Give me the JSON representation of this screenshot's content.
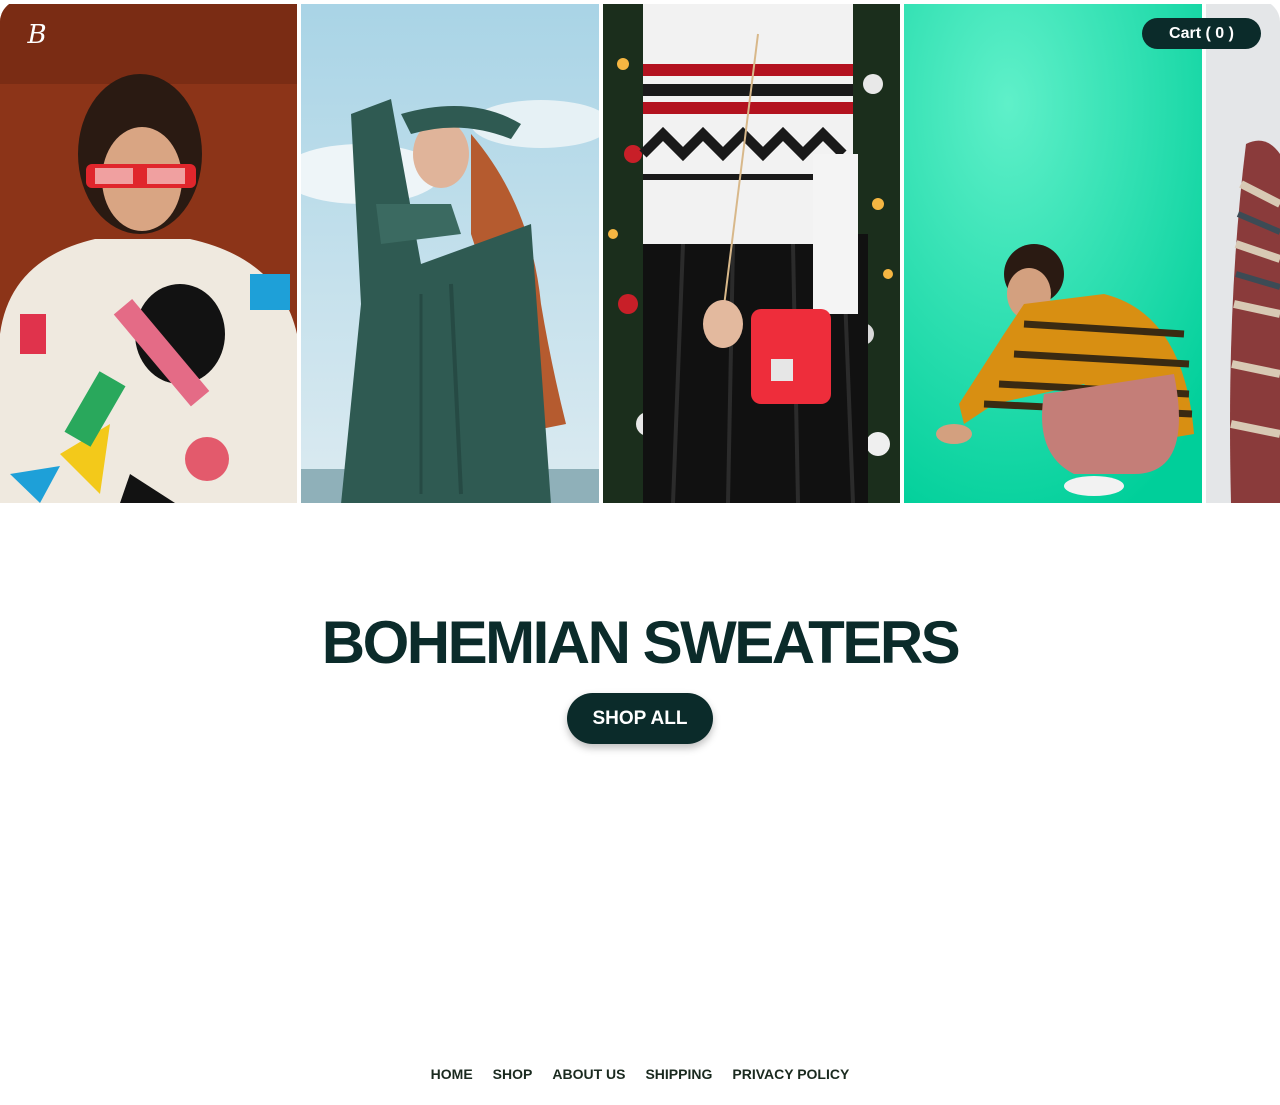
{
  "brand": {
    "logo_letter": "B"
  },
  "header": {
    "cart_label": "Cart ( 0 )"
  },
  "gallery": {
    "photos": [
      {
        "alt": "woman in colorful abstract knit sweater"
      },
      {
        "alt": "woman in green cable knit sweater"
      },
      {
        "alt": "woman in red and white fair isle sweater"
      },
      {
        "alt": "man in striped sweater on green backdrop"
      },
      {
        "alt": "person in patterned knit wrap"
      }
    ]
  },
  "hero": {
    "title": "BOHEMIAN SWEATERS",
    "cta_label": "SHOP ALL"
  },
  "footer": {
    "links": [
      "HOME",
      "SHOP",
      "ABOUT US",
      "SHIPPING",
      "PRIVACY POLICY"
    ]
  },
  "colors": {
    "brand_dark": "#0b2b2a",
    "footer_text": "#1a2a1f"
  }
}
